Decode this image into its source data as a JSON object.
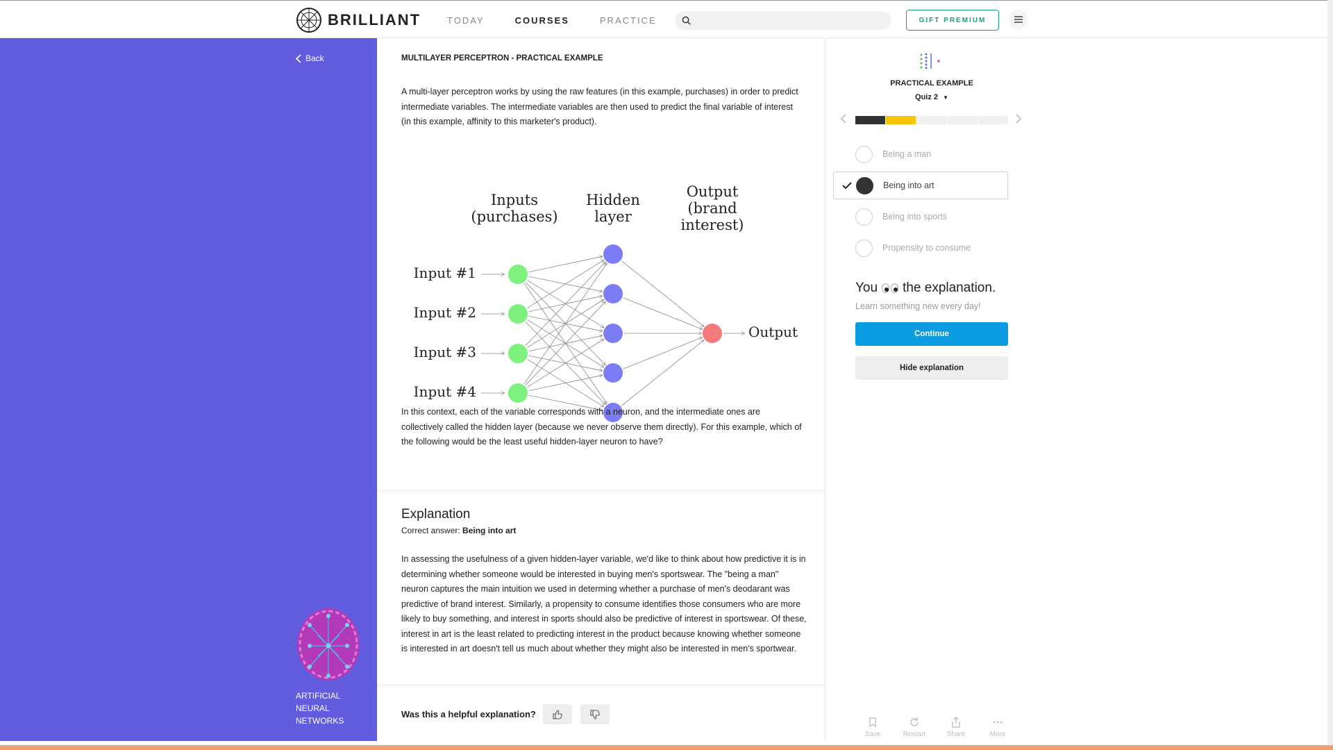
{
  "header": {
    "brand": "BRILLIANT",
    "nav": [
      "TODAY",
      "COURSES",
      "PRACTICE"
    ],
    "active_nav": "COURSES",
    "search_placeholder": "",
    "gift_label": "GIFT PREMIUM"
  },
  "sidebar": {
    "back_label": "Back",
    "course_name": "ARTIFICIAL NEURAL NETWORKS"
  },
  "main": {
    "title": "MULTILAYER PERCEPTRON - PRACTICAL EXAMPLE",
    "intro": "A multi-layer perceptron works by using the raw features (in this example, purchases) in order to predict intermediate variables. The intermediate variables are then used to predict the final variable of interest (in this example, affinity to this marketer's product).",
    "diagram": {
      "inputs_heading": [
        "Inputs",
        "(purchases)"
      ],
      "hidden_heading": [
        "Hidden",
        "layer"
      ],
      "output_heading": [
        "Output",
        "(brand",
        "interest)"
      ],
      "input_labels": [
        "Input #1",
        "Input #2",
        "Input #3",
        "Input #4"
      ],
      "output_label": "Output",
      "colors": {
        "input": "#7ef07e",
        "hidden": "#7c7cf5",
        "output": "#f57a7a"
      }
    },
    "question": "In this context, each of the variable corresponds with a neuron, and the intermediate ones are collectively called the hidden layer (because we never observe them directly). For this example, which of the following would be the least useful hidden-layer neuron to have?",
    "explanation_title": "Explanation",
    "correct_prefix": "Correct answer:",
    "correct_answer": "Being into art",
    "explanation_body": "In assessing the usefulness of a given hidden-layer variable, we'd like to think about how predictive it is in determining whether someone would be interested in buying men's sportswear. The \"being a man\" neuron captures the main intuition we used in determing whether a purchase of men's deodarant was predictive of brand interest. Similarly, a propensity to consume identifies those consumers who are more likely to buy something, and interest in sports should also be predictive of interest in sportswear. Of these, interest in art is the least related to predicting interest in the product because knowing whether someone is interested in art doesn't tell us much about whether they might also be interested in men's sportwear.",
    "helpful_label": "Was this a helpful explanation?"
  },
  "panel": {
    "quiz_title": "PRACTICAL EXAMPLE",
    "quiz_sub": "Quiz 2",
    "progress": {
      "total": 5,
      "completed": 1,
      "current": 2
    },
    "options": [
      "Being a man",
      "Being into art",
      "Being into sports",
      "Propensity to consume"
    ],
    "selected_option": 1,
    "explain_pre": "You",
    "explain_post": "the explanation.",
    "explain_sub": "Learn something new every day!",
    "continue_label": "Continue",
    "hide_label": "Hide explanation",
    "tools": [
      "Save",
      "Restart",
      "Share",
      "More"
    ]
  }
}
